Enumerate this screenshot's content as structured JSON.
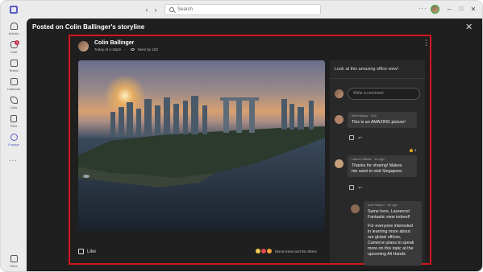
{
  "titlebar": {
    "search_placeholder": "Search",
    "back_icon": "chevron-left-icon",
    "forward_icon": "chevron-right-icon",
    "more_label": "···",
    "minimize": "–",
    "maximize": "□",
    "close": "✕"
  },
  "rail": {
    "items": [
      {
        "label": "Activity",
        "icon": "bell-icon"
      },
      {
        "label": "Chat",
        "icon": "chat-icon",
        "badge": "1"
      },
      {
        "label": "Teams",
        "icon": "teams-icon"
      },
      {
        "label": "Calendar",
        "icon": "calendar-icon"
      },
      {
        "label": "Calls",
        "icon": "phone-icon"
      },
      {
        "label": "Files",
        "icon": "file-icon"
      },
      {
        "label": "Engage",
        "icon": "engage-icon"
      }
    ],
    "more_label": "···",
    "store_label": "Store"
  },
  "view": {
    "title": "Posted on Colin Ballinger's storyline",
    "close": "✕"
  },
  "post": {
    "author": "Colin Ballinger",
    "time": "Today at 4:15pm",
    "seen": "Seen by 182",
    "more": "⋮",
    "like_label": "Like",
    "reactions_text": "Mona Kane and 55 others",
    "caption": "Look at this amazing office view!",
    "composer_placeholder": "Write a comment"
  },
  "comments": [
    {
      "author": "Wira Wijaya",
      "time": "21m",
      "text_lines": [
        "This is an AMAZING picture!"
      ],
      "avatar_color": "#b0846a"
    },
    {
      "author": "Lauren Gillette",
      "time": "1m ago",
      "text_lines": [
        "Thanks for sharing! Makes",
        "me want to visit Singapore."
      ],
      "avatar_color": "#c5a07a",
      "reaction_count": "1"
    },
    {
      "author": "Avel Serpon",
      "time": "1m ago",
      "text_lines": [
        "Same here, Laurence!",
        "Fantastic view indeed!",
        "",
        "For everyone interested",
        "in learning more about",
        "our global offices,",
        "Cameron plans to speak",
        "more on this topic at the",
        "upcoming All Hands"
      ],
      "avatar_color": "#8a6a55"
    }
  ],
  "colors": {
    "accent": "#5b5fc7",
    "highlight_border": "#d1161e",
    "badge": "#c4314b"
  }
}
